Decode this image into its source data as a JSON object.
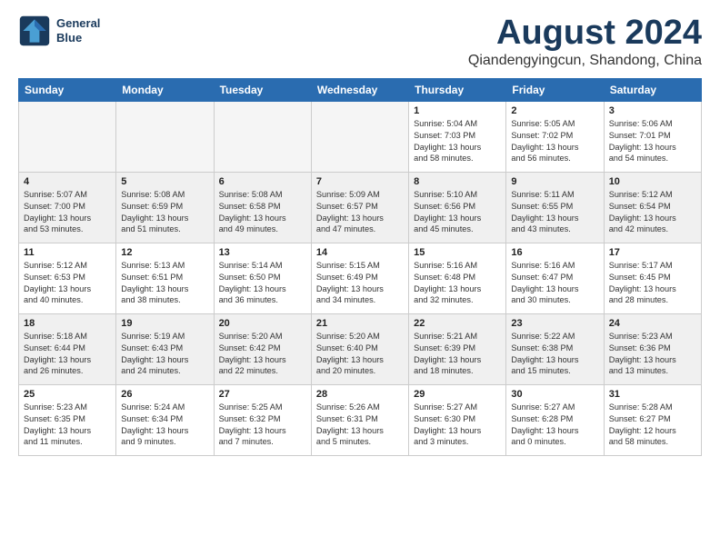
{
  "header": {
    "logo_line1": "General",
    "logo_line2": "Blue",
    "month": "August 2024",
    "location": "Qiandengyingcun, Shandong, China"
  },
  "weekdays": [
    "Sunday",
    "Monday",
    "Tuesday",
    "Wednesday",
    "Thursday",
    "Friday",
    "Saturday"
  ],
  "weeks": [
    [
      {
        "day": "",
        "info": "",
        "empty": true
      },
      {
        "day": "",
        "info": "",
        "empty": true
      },
      {
        "day": "",
        "info": "",
        "empty": true
      },
      {
        "day": "",
        "info": "",
        "empty": true
      },
      {
        "day": "1",
        "info": "Sunrise: 5:04 AM\nSunset: 7:03 PM\nDaylight: 13 hours\nand 58 minutes.",
        "empty": false
      },
      {
        "day": "2",
        "info": "Sunrise: 5:05 AM\nSunset: 7:02 PM\nDaylight: 13 hours\nand 56 minutes.",
        "empty": false
      },
      {
        "day": "3",
        "info": "Sunrise: 5:06 AM\nSunset: 7:01 PM\nDaylight: 13 hours\nand 54 minutes.",
        "empty": false
      }
    ],
    [
      {
        "day": "4",
        "info": "Sunrise: 5:07 AM\nSunset: 7:00 PM\nDaylight: 13 hours\nand 53 minutes.",
        "empty": false
      },
      {
        "day": "5",
        "info": "Sunrise: 5:08 AM\nSunset: 6:59 PM\nDaylight: 13 hours\nand 51 minutes.",
        "empty": false
      },
      {
        "day": "6",
        "info": "Sunrise: 5:08 AM\nSunset: 6:58 PM\nDaylight: 13 hours\nand 49 minutes.",
        "empty": false
      },
      {
        "day": "7",
        "info": "Sunrise: 5:09 AM\nSunset: 6:57 PM\nDaylight: 13 hours\nand 47 minutes.",
        "empty": false
      },
      {
        "day": "8",
        "info": "Sunrise: 5:10 AM\nSunset: 6:56 PM\nDaylight: 13 hours\nand 45 minutes.",
        "empty": false
      },
      {
        "day": "9",
        "info": "Sunrise: 5:11 AM\nSunset: 6:55 PM\nDaylight: 13 hours\nand 43 minutes.",
        "empty": false
      },
      {
        "day": "10",
        "info": "Sunrise: 5:12 AM\nSunset: 6:54 PM\nDaylight: 13 hours\nand 42 minutes.",
        "empty": false
      }
    ],
    [
      {
        "day": "11",
        "info": "Sunrise: 5:12 AM\nSunset: 6:53 PM\nDaylight: 13 hours\nand 40 minutes.",
        "empty": false
      },
      {
        "day": "12",
        "info": "Sunrise: 5:13 AM\nSunset: 6:51 PM\nDaylight: 13 hours\nand 38 minutes.",
        "empty": false
      },
      {
        "day": "13",
        "info": "Sunrise: 5:14 AM\nSunset: 6:50 PM\nDaylight: 13 hours\nand 36 minutes.",
        "empty": false
      },
      {
        "day": "14",
        "info": "Sunrise: 5:15 AM\nSunset: 6:49 PM\nDaylight: 13 hours\nand 34 minutes.",
        "empty": false
      },
      {
        "day": "15",
        "info": "Sunrise: 5:16 AM\nSunset: 6:48 PM\nDaylight: 13 hours\nand 32 minutes.",
        "empty": false
      },
      {
        "day": "16",
        "info": "Sunrise: 5:16 AM\nSunset: 6:47 PM\nDaylight: 13 hours\nand 30 minutes.",
        "empty": false
      },
      {
        "day": "17",
        "info": "Sunrise: 5:17 AM\nSunset: 6:45 PM\nDaylight: 13 hours\nand 28 minutes.",
        "empty": false
      }
    ],
    [
      {
        "day": "18",
        "info": "Sunrise: 5:18 AM\nSunset: 6:44 PM\nDaylight: 13 hours\nand 26 minutes.",
        "empty": false
      },
      {
        "day": "19",
        "info": "Sunrise: 5:19 AM\nSunset: 6:43 PM\nDaylight: 13 hours\nand 24 minutes.",
        "empty": false
      },
      {
        "day": "20",
        "info": "Sunrise: 5:20 AM\nSunset: 6:42 PM\nDaylight: 13 hours\nand 22 minutes.",
        "empty": false
      },
      {
        "day": "21",
        "info": "Sunrise: 5:20 AM\nSunset: 6:40 PM\nDaylight: 13 hours\nand 20 minutes.",
        "empty": false
      },
      {
        "day": "22",
        "info": "Sunrise: 5:21 AM\nSunset: 6:39 PM\nDaylight: 13 hours\nand 18 minutes.",
        "empty": false
      },
      {
        "day": "23",
        "info": "Sunrise: 5:22 AM\nSunset: 6:38 PM\nDaylight: 13 hours\nand 15 minutes.",
        "empty": false
      },
      {
        "day": "24",
        "info": "Sunrise: 5:23 AM\nSunset: 6:36 PM\nDaylight: 13 hours\nand 13 minutes.",
        "empty": false
      }
    ],
    [
      {
        "day": "25",
        "info": "Sunrise: 5:23 AM\nSunset: 6:35 PM\nDaylight: 13 hours\nand 11 minutes.",
        "empty": false
      },
      {
        "day": "26",
        "info": "Sunrise: 5:24 AM\nSunset: 6:34 PM\nDaylight: 13 hours\nand 9 minutes.",
        "empty": false
      },
      {
        "day": "27",
        "info": "Sunrise: 5:25 AM\nSunset: 6:32 PM\nDaylight: 13 hours\nand 7 minutes.",
        "empty": false
      },
      {
        "day": "28",
        "info": "Sunrise: 5:26 AM\nSunset: 6:31 PM\nDaylight: 13 hours\nand 5 minutes.",
        "empty": false
      },
      {
        "day": "29",
        "info": "Sunrise: 5:27 AM\nSunset: 6:30 PM\nDaylight: 13 hours\nand 3 minutes.",
        "empty": false
      },
      {
        "day": "30",
        "info": "Sunrise: 5:27 AM\nSunset: 6:28 PM\nDaylight: 13 hours\nand 0 minutes.",
        "empty": false
      },
      {
        "day": "31",
        "info": "Sunrise: 5:28 AM\nSunset: 6:27 PM\nDaylight: 12 hours\nand 58 minutes.",
        "empty": false
      }
    ]
  ]
}
